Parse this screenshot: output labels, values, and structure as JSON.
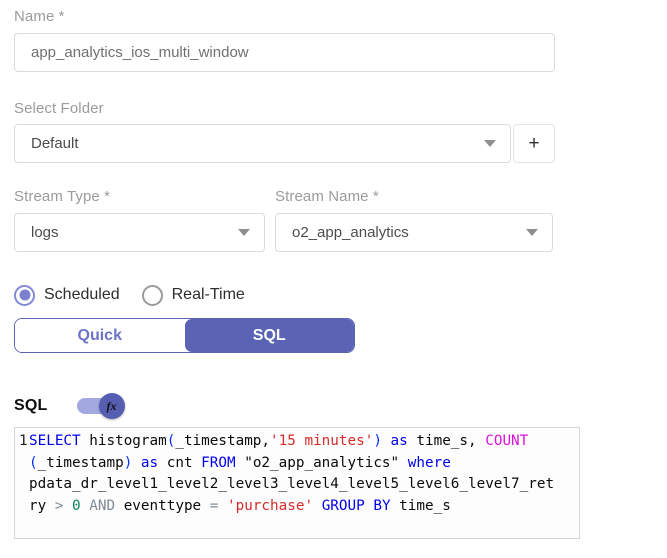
{
  "form": {
    "name": {
      "label": "Name *",
      "value": "app_analytics_ios_multi_window"
    },
    "folder": {
      "label": "Select Folder",
      "value": "Default",
      "add_button_label": "+"
    },
    "stream_type": {
      "label": "Stream Type *",
      "value": "logs"
    },
    "stream_name": {
      "label": "Stream Name *",
      "value": "o2_app_analytics"
    },
    "mode": {
      "options": [
        {
          "label": "Scheduled",
          "selected": true
        },
        {
          "label": "Real-Time",
          "selected": false
        }
      ]
    },
    "tabs": [
      {
        "label": "Quick",
        "active": false
      },
      {
        "label": "SQL",
        "active": true
      }
    ],
    "sql_section": {
      "label": "SQL",
      "toggle_icon": "fx",
      "toggle_on": true
    }
  },
  "colors": {
    "accent_indigo": "#5a63b4",
    "radio_indigo": "#7a81d0",
    "label_gray": "#9b9b9b",
    "keyword_blue": "#0000ee",
    "function_magenta": "#da12da",
    "string_red": "#d52b2b",
    "number_green": "#098658",
    "operator_gray": "#7f8c98"
  },
  "sql_editor": {
    "query_text": "SELECT histogram(_timestamp,'15 minutes') as time_s, COUNT(_timestamp) as cnt FROM \"o2_app_analytics\" where pdata_dr_level1_level2_level3_level4_level5_level6_level7_retry > 0 AND eventtype = 'purchase' GROUP BY time_s",
    "lines": [
      {
        "number": "1",
        "tokens": [
          {
            "t": "SELECT",
            "c": "kw"
          },
          {
            "t": " histogram",
            "c": "id"
          },
          {
            "t": "(",
            "c": "br"
          },
          {
            "t": "_timestamp,",
            "c": "id"
          },
          {
            "t": "'15 minutes'",
            "c": "str"
          },
          {
            "t": ")",
            "c": "br"
          },
          {
            "t": " ",
            "c": "id"
          },
          {
            "t": "as",
            "c": "kw"
          },
          {
            "t": " time_s, ",
            "c": "id"
          },
          {
            "t": "COUNT",
            "c": "fn"
          }
        ]
      },
      {
        "number": "",
        "tokens": [
          {
            "t": "(",
            "c": "br"
          },
          {
            "t": "_timestamp",
            "c": "id"
          },
          {
            "t": ")",
            "c": "br"
          },
          {
            "t": " ",
            "c": "id"
          },
          {
            "t": "as",
            "c": "kw"
          },
          {
            "t": " cnt ",
            "c": "id"
          },
          {
            "t": "FROM",
            "c": "kw"
          },
          {
            "t": " \"o2_app_analytics\" ",
            "c": "id"
          },
          {
            "t": "where",
            "c": "kw"
          }
        ]
      },
      {
        "number": "",
        "tokens": [
          {
            "t": "pdata_dr_level1_level2_level3_level4_level5_level6_level7_ret",
            "c": "id"
          }
        ]
      },
      {
        "number": "",
        "tokens": [
          {
            "t": "ry ",
            "c": "id"
          },
          {
            "t": "> ",
            "c": "op"
          },
          {
            "t": "0",
            "c": "num"
          },
          {
            "t": " ",
            "c": "id"
          },
          {
            "t": "AND",
            "c": "op"
          },
          {
            "t": " eventtype ",
            "c": "id"
          },
          {
            "t": "= ",
            "c": "op"
          },
          {
            "t": "'purchase'",
            "c": "str"
          },
          {
            "t": " ",
            "c": "id"
          },
          {
            "t": "GROUP BY",
            "c": "kw"
          },
          {
            "t": " time_s",
            "c": "id"
          }
        ]
      }
    ]
  }
}
